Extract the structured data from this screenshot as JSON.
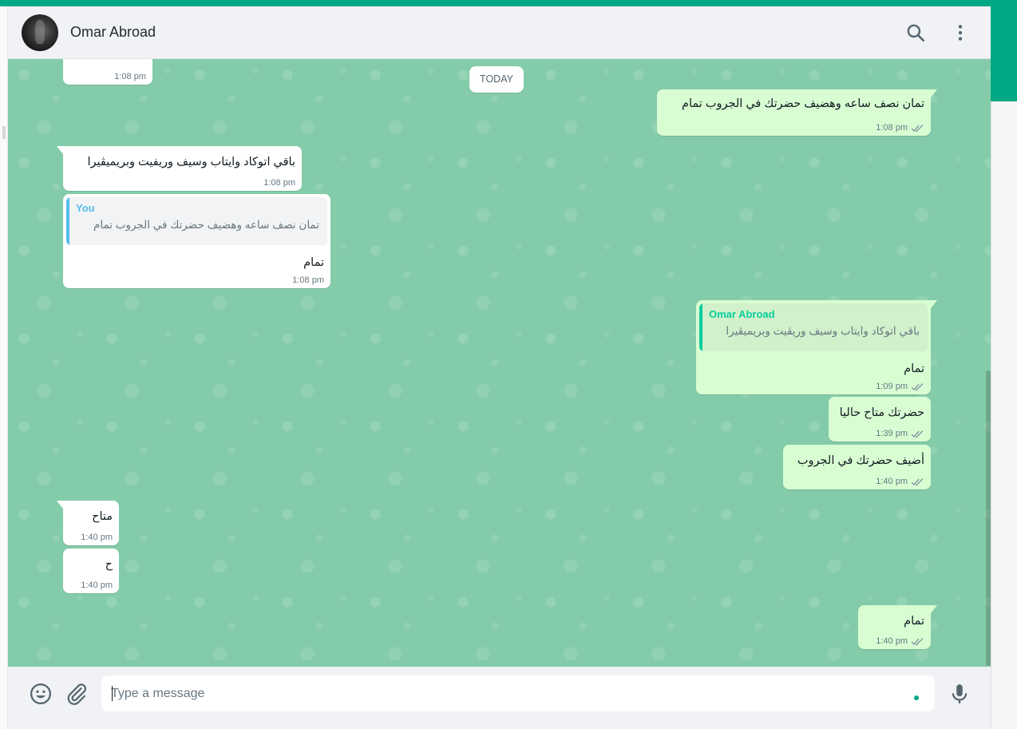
{
  "header": {
    "contact_name": "Omar Abroad"
  },
  "day_chip": "TODAY",
  "messages": [
    {
      "dir": "in",
      "text": "",
      "time": "1:08 pm"
    },
    {
      "dir": "out",
      "text": "تمان نصف ساعه وهضيف حضرتك في الجروب تمام",
      "time": "1:08 pm"
    },
    {
      "dir": "in",
      "text": "باقي اتوكاد وايتاب وسيف وريفيت وبريميڤيرا",
      "time": "1:08 pm"
    },
    {
      "dir": "in",
      "quote_author": "You",
      "quote_text": "تمان نصف ساعه وهضيف حضرتك في الجروب تمام",
      "text": "تمام",
      "time": "1:08 pm"
    },
    {
      "dir": "out",
      "quote_author": "Omar Abroad",
      "quote_text": "باقي اتوكاد وايتاب وسيف وريڤيت وبريميڤيرا",
      "text": "تمام",
      "time": "1:09 pm"
    },
    {
      "dir": "out",
      "text": "حضرتك متاح حاليا",
      "time": "1:39 pm"
    },
    {
      "dir": "out",
      "text": "أضيف حضرتك في الجروب",
      "time": "1:40 pm"
    },
    {
      "dir": "in",
      "text": "متاح",
      "time": "1:40 pm"
    },
    {
      "dir": "in",
      "text": "ح",
      "time": "1:40 pm"
    },
    {
      "dir": "out",
      "text": "تمام",
      "time": "1:40 pm"
    }
  ],
  "composer": {
    "placeholder": "Type a message"
  },
  "colors": {
    "accent": "#00a884",
    "wallpaper": "#84cca9",
    "outgoing_bubble": "#d9fdd3",
    "incoming_bubble": "#ffffff",
    "quote_you": "#53bdeb",
    "quote_contact": "#06cf9c"
  },
  "icons": [
    "search-icon",
    "menu-icon",
    "emoji-icon",
    "attach-icon",
    "mic-icon",
    "double-check-icon"
  ]
}
